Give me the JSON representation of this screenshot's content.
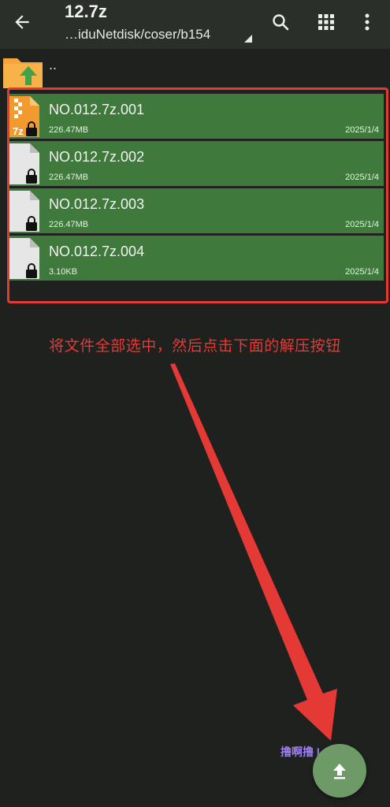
{
  "appbar": {
    "title": "12.7z",
    "path": "…iduNetdisk/coser/b154",
    "back_icon": "arrow-left-icon",
    "search_icon": "search-icon",
    "grid_icon": "grid-view-icon",
    "more_icon": "more-vert-icon"
  },
  "parent": {
    "label": ".."
  },
  "files": [
    {
      "name": "NO.012.7z.001",
      "size": "226.47MB",
      "date": "2025/1/4",
      "icon": "7z-archive-icon"
    },
    {
      "name": "NO.012.7z.002",
      "size": "226.47MB",
      "date": "2025/1/4",
      "icon": "locked-file-icon"
    },
    {
      "name": "NO.012.7z.003",
      "size": "226.47MB",
      "date": "2025/1/4",
      "icon": "locked-file-icon"
    },
    {
      "name": "NO.012.7z.004",
      "size": "3.10KB",
      "date": "2025/1/4",
      "icon": "locked-file-icon"
    }
  ],
  "annotation": {
    "instruction": "将文件全部选中，然后点击下面的解压按钮",
    "watermark": "撸啊撸 LOL"
  },
  "fab": {
    "icon": "extract-upload-icon"
  },
  "colors": {
    "background": "#1e211e",
    "appbar": "#2a3029",
    "selected_row": "#3f7a3c",
    "annotation_red": "#e53935",
    "fab": "#6e9a68"
  }
}
